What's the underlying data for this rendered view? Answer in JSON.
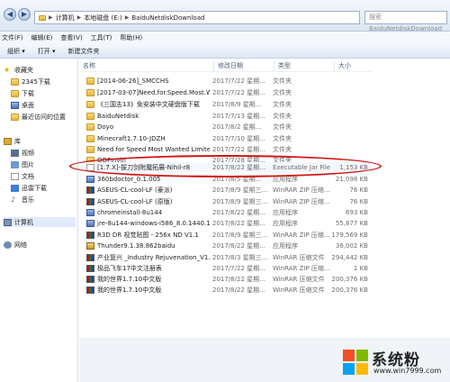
{
  "addressbar": {
    "path": [
      "计算机",
      "本地磁盘 (E:)",
      "BaiduNetdiskDownload"
    ],
    "search_placeholder": "搜索 BaiduNetdiskDownload"
  },
  "menu": [
    "文件(F)",
    "编辑(E)",
    "查看(V)",
    "工具(T)",
    "帮助(H)"
  ],
  "toolbar": {
    "organize": "组织 ▾",
    "open": "打开 ▾",
    "new_folder": "新建文件夹"
  },
  "sidebar": {
    "favorites": "收藏夹",
    "fav_items": [
      "2345下载",
      "下载",
      "桌面",
      "最近访问的位置"
    ],
    "library": "库",
    "lib_items": [
      "视频",
      "图片",
      "文档",
      "迅雷下载",
      "音乐"
    ],
    "computer": "计算机",
    "network": "网络"
  },
  "columns": {
    "name": "名称",
    "date": "修改日期",
    "type": "类型",
    "size": "大小"
  },
  "files": [
    {
      "name": "[2014-06-26]_SMCCHS",
      "date": "2017/7/22 星期...",
      "type": "文件夹",
      "size": "",
      "icon": "folder"
    },
    {
      "name": "[2017-03-07]Need.for.Speed.Most.W...",
      "date": "2017/7/22 星期...",
      "type": "文件夹",
      "size": "",
      "icon": "folder"
    },
    {
      "name": "《三国志13》免安装中文硬盘版下载",
      "date": "2017/8/9 星期...",
      "type": "文件夹",
      "size": "",
      "icon": "folder"
    },
    {
      "name": "BaiduNetdisk",
      "date": "2017/7/13 星期...",
      "type": "文件夹",
      "size": "",
      "icon": "folder"
    },
    {
      "name": "Doyo",
      "date": "2017/8/2 星期...",
      "type": "文件夹",
      "size": "",
      "icon": "folder"
    },
    {
      "name": "Minecraft1.7.10-JDZH",
      "date": "2017/7/10 星期...",
      "type": "文件夹",
      "size": "",
      "icon": "folder"
    },
    {
      "name": "Need for Speed Most Wanted Limite...",
      "date": "2017/7/22 星期...",
      "type": "文件夹",
      "size": "",
      "icon": "folder"
    },
    {
      "name": "QQPinyin",
      "date": "2017/7/28 星期...",
      "type": "文件夹",
      "size": "",
      "icon": "folder"
    },
    {
      "name": "[1.7.X]-拔刀剑附魔拓展-Nihil-r8",
      "date": "2017/8/22 星期...",
      "type": "Executable Jar File",
      "size": "1,153 KB",
      "icon": "jar"
    },
    {
      "name": "360bdoctor_0.1.005",
      "date": "2017/8/5 星期...",
      "type": "应用程序",
      "size": "21,098 KB",
      "icon": "app"
    },
    {
      "name": "ASEUS-CL-cool-LF (豪派)",
      "date": "2017/8/9 星期三...",
      "type": "WinRAR ZIP 压缩...",
      "size": "76 KB",
      "icon": "zip"
    },
    {
      "name": "ASEUS-CL-cool-LF (原版)",
      "date": "2017/8/9 星期三...",
      "type": "WinRAR ZIP 压缩...",
      "size": "76 KB",
      "icon": "zip"
    },
    {
      "name": "chromeinstall-8u144",
      "date": "2017/8/22 星期...",
      "type": "应用程序",
      "size": "693 KB",
      "icon": "app"
    },
    {
      "name": "jre-8u144-windows-i586_8.0.1440.1",
      "date": "2017/8/22 星期...",
      "type": "应用程序",
      "size": "55,877 KB",
      "icon": "app"
    },
    {
      "name": "R3D DR 视觉贴图 - 256x ND V1.1",
      "date": "2017/8/9 星期三...",
      "type": "WinRAR ZIP 压缩...",
      "size": "179,569 KB",
      "icon": "zip"
    },
    {
      "name": "Thunder9.1.38.862baidu",
      "date": "2017/8/22 星期...",
      "type": "应用程序",
      "size": "36,002 KB",
      "icon": "exe2"
    },
    {
      "name": "产业复兴 _Industry Rejuvenation_V1.0...",
      "date": "2017/8/3 星期三...",
      "type": "WinRAR 压缩文件",
      "size": "294,442 KB",
      "icon": "zip"
    },
    {
      "name": "极品飞车17中文注册表",
      "date": "2017/7/22 星期...",
      "type": "WinRAR ZIP 压缩...",
      "size": "1 KB",
      "icon": "zip"
    },
    {
      "name": "我的世界1.7.10中文版",
      "date": "2017/8/22 星期...",
      "type": "WinRAR 压缩文件",
      "size": "200,376 KB",
      "icon": "zip"
    },
    {
      "name": "我的世界1.7.10中文版",
      "date": "2017/8/22 星期...",
      "type": "WinRAR 压缩文件",
      "size": "200,376 KB",
      "icon": "zip"
    }
  ],
  "watermark": {
    "text": "系统粉",
    "url": "www.win7999.com"
  }
}
